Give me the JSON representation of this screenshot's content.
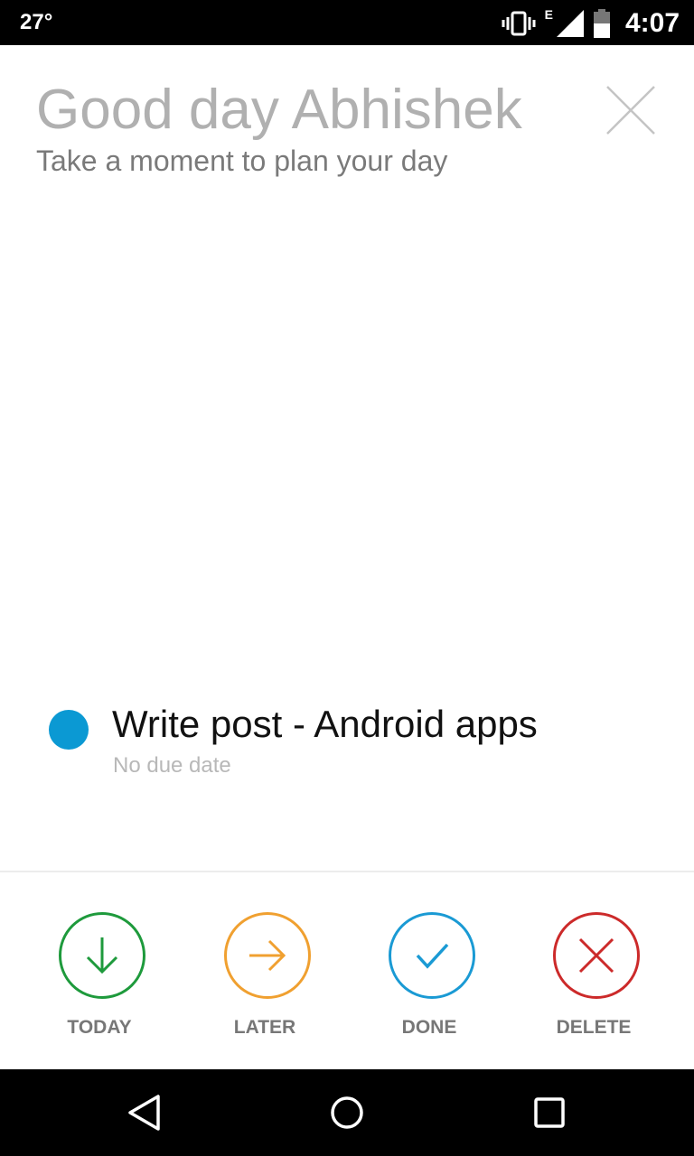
{
  "status_bar": {
    "temperature": "27°",
    "network": "E",
    "time": "4:07",
    "icons": [
      "vibrate-icon",
      "signal-icon",
      "battery-icon"
    ]
  },
  "header": {
    "greeting": "Good day Abhishek",
    "subtitle": "Take a moment to plan your day"
  },
  "task": {
    "title": "Write post - Android apps",
    "due": "No due date",
    "dot_color": "#0b99d3"
  },
  "actions": [
    {
      "label": "TODAY",
      "color": "#1e9a3c",
      "icon": "arrow-down-icon"
    },
    {
      "label": "LATER",
      "color": "#f0a030",
      "icon": "arrow-right-icon"
    },
    {
      "label": "DONE",
      "color": "#1a9ad4",
      "icon": "checkmark-icon"
    },
    {
      "label": "DELETE",
      "color": "#cc2a2a",
      "icon": "x-icon"
    }
  ],
  "nav": {
    "icons": [
      "back-icon",
      "home-icon",
      "recents-icon"
    ]
  }
}
